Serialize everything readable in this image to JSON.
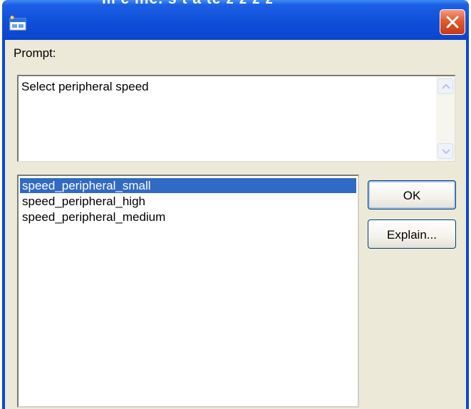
{
  "window": {
    "title": "",
    "top_cut_text": "m e ilie. s t a te z z z z"
  },
  "icons": {
    "app": "app-window-icon",
    "close": "close-icon",
    "scroll_up": "chevron-up-icon",
    "scroll_down": "chevron-down-icon"
  },
  "prompt": {
    "label": "Prompt:",
    "text": "Select peripheral speed"
  },
  "options": {
    "items": [
      {
        "label": "speed_peripheral_small",
        "selected": true
      },
      {
        "label": "speed_peripheral_high",
        "selected": false
      },
      {
        "label": "speed_peripheral_medium",
        "selected": false
      }
    ]
  },
  "buttons": {
    "ok": "OK",
    "explain": "Explain..."
  },
  "colors": {
    "titlebar": "#0f4fd9",
    "selection": "#316ac5",
    "dialog_bg": "#ece9d8",
    "close_button": "#e25a2e"
  }
}
